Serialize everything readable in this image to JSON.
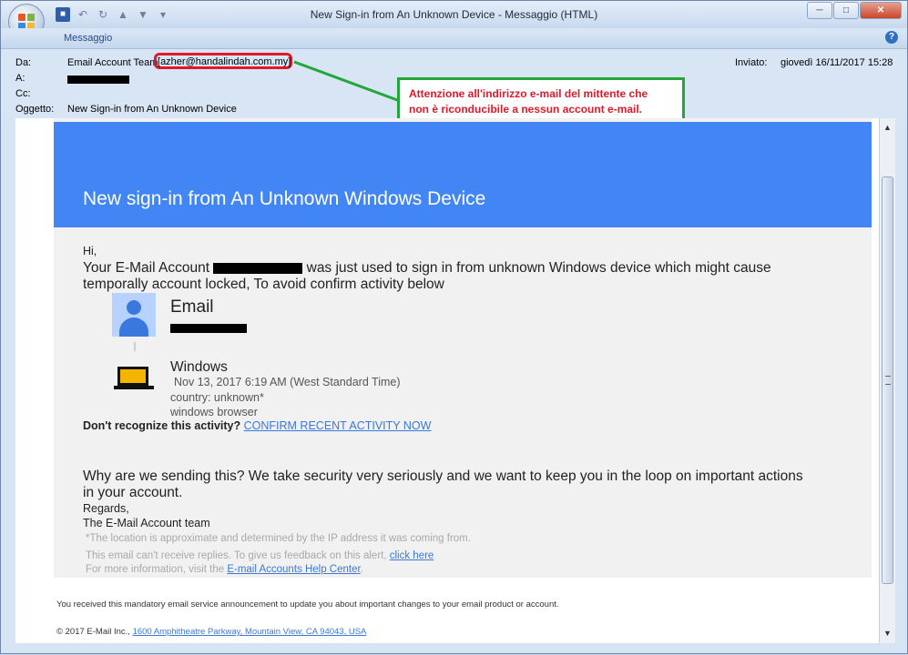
{
  "window": {
    "title": "New Sign-in from An Unknown Device - Messaggio (HTML)",
    "controls": {
      "minimize": "─",
      "maximize": "□",
      "close": "✕"
    }
  },
  "ribbon": {
    "tab": "Messaggio",
    "help": "?"
  },
  "header": {
    "from_label": "Da:",
    "from_name": "Email Account Team",
    "from_email": "azher@handalindah.com.my]",
    "to_label": "A:",
    "cc_label": "Cc:",
    "subject_label": "Oggetto:",
    "subject": "New Sign-in from An Unknown Device",
    "sent_label": "Inviato:",
    "sent_value": "giovedì 16/11/2017 15:28"
  },
  "annotation": {
    "line1": "Attenzione all'indirizzo e-mail del mittente che",
    "line2": "non è riconducibile a nessun account e-mail.",
    "color": "#e0182a",
    "border_color": "#23a63a"
  },
  "email": {
    "banner_title": "New sign-in from An Unknown Windows Device",
    "greeting": "Hi,",
    "intro_a": "Your E-Mail Account ",
    "intro_b": " was just used to sign in from unknown Windows device which might cause",
    "intro_c": "temporally account locked, To avoid confirm activity below",
    "account_heading": "Email",
    "device_name": "Windows",
    "device_date": "Nov 13, 2017 6:19 AM (West Standard Time)",
    "device_country": "country: unknown*",
    "device_browser": "windows browser",
    "dont_recognize": "Don't recognize this activity?",
    "confirm_link": "CONFIRM RECENT ACTIVITY NOW",
    "why_line1": "Why are we sending this? We take security very seriously and we want to keep you in the loop on important actions",
    "why_line2": "in your account.",
    "regards": "Regards,",
    "team": "The E-Mail Account team",
    "note_location": "*The location is approximate and determined by the IP address it was coming from.",
    "note_replies": "This email can't receive replies. To give us feedback on this alert, ",
    "click_here": "click here",
    "note_more": "For more information, visit the ",
    "help_center": "E-mail Accounts Help Center",
    "note_more_end": ".",
    "footer_notice": "You received this mandatory email service announcement to update you about important changes to your email product or account.",
    "footer_copyright": "© 2017 E-Mail Inc., ",
    "footer_address": "1600 Amphitheatre Parkway, Mountain View, CA 94043, USA",
    "banner_color": "#4285f4",
    "link_color": "#3a78d9"
  }
}
